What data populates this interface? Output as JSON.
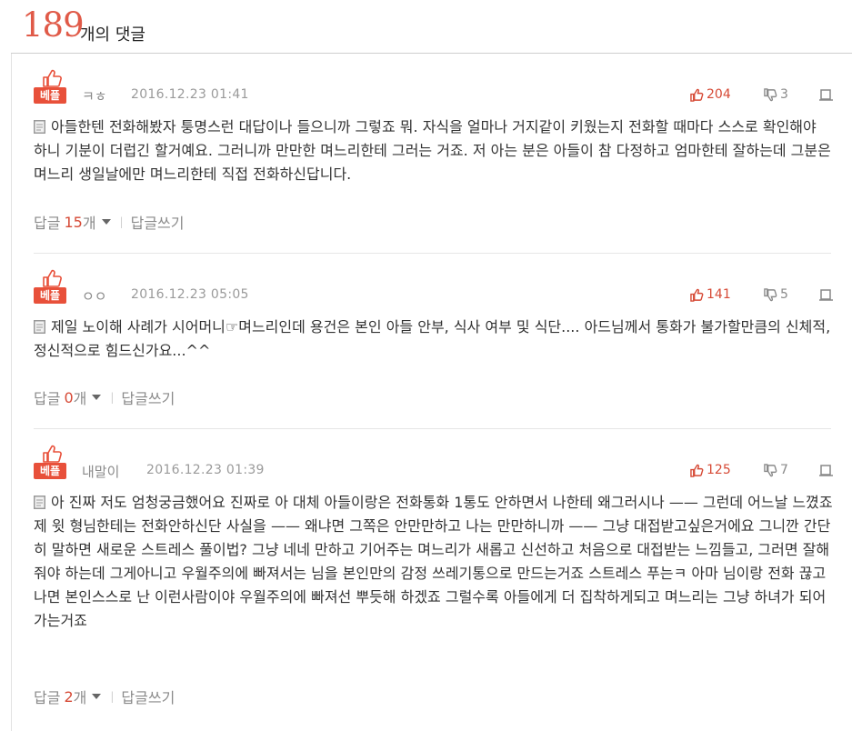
{
  "header": {
    "count": "189",
    "suffix": "개의 댓글"
  },
  "colors": {
    "accent": "#e05a48",
    "badge": "#e8503a"
  },
  "comments": [
    {
      "badge_label": "베플",
      "author": "ㅋㅎ",
      "date": "2016.12.23 01:41",
      "likes": "204",
      "dislikes": "3",
      "body": "아들한텐 전화해봤자 퉁명스런 대답이나 들으니까 그렇죠 뭐. 자식을 얼마나 거지같이 키웠는지 전화할 때마다 스스로 확인해야 하니 기분이 더럽긴 할거예요. 그러니까 만만한 며느리한테 그러는 거죠. 저 아는 분은 아들이 참 다정하고 엄마한테 잘하는데 그분은 며느리 생일날에만 며느리한테 직접 전화하신답니다.",
      "reply_label": "답글",
      "reply_count": "15",
      "reply_unit": "개",
      "write_label": "답글쓰기"
    },
    {
      "badge_label": "베플",
      "author": "ㅇㅇ",
      "date": "2016.12.23 05:05",
      "likes": "141",
      "dislikes": "5",
      "body": "제일 노이해 사례가 시어머니☞며느리인데 용건은 본인 아들 안부, 식사 여부 및 식단.... 아드님께서 통화가 불가할만큼의 신체적, 정신적으로 힘드신가요...^^",
      "reply_label": "답글",
      "reply_count": "0",
      "reply_unit": "개",
      "write_label": "답글쓰기"
    },
    {
      "badge_label": "베플",
      "author": "내말이",
      "date": "2016.12.23 01:39",
      "likes": "125",
      "dislikes": "7",
      "body": "아 진짜 저도 엄청궁금했어요 진짜로 아 대체 아들이랑은 전화통화 1통도 안하면서 나한테 왜그러시나 —— 그런데 어느날 느꼈죠 제 윗 형님한테는 전화안하신단 사실을 —— 왜냐면 그쪽은 안만만하고 나는 만만하니까 —— 그냥 대접받고싶은거에요 그니깐 간단히 말하면 새로운 스트레스 풀이법? 그냥 네네 만하고 기어주는 며느리가 새롭고 신선하고 처음으로 대접받는 느낌들고, 그러면 잘해줘야 하는데 그게아니고 우월주의에 빠져서는 님을 본인만의 감정 쓰레기통으로 만드는거죠 스트레스 푸는ㅋ 아마 님이랑 전화 끊고나면 본인스스로 난 이런사람이야 우월주의에 빠져선 뿌듯해 하겠죠 그럴수록 아들에게 더 집착하게되고 며느리는 그냥 하녀가 되어가는거죠",
      "reply_label": "답글",
      "reply_count": "2",
      "reply_unit": "개",
      "write_label": "답글쓰기"
    }
  ]
}
